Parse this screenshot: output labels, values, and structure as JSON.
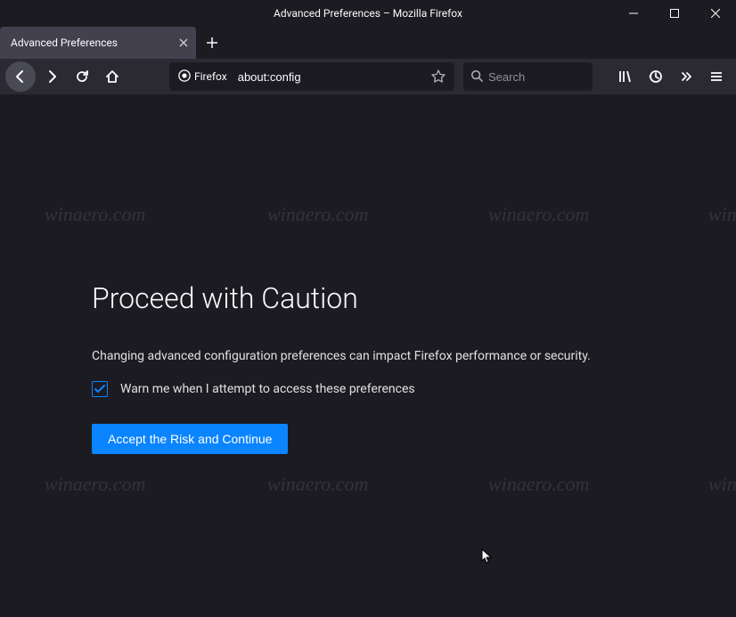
{
  "window": {
    "title": "Advanced Preferences – Mozilla Firefox"
  },
  "tab": {
    "label": "Advanced Preferences"
  },
  "urlbar": {
    "identity_label": "Firefox",
    "value": "about:config"
  },
  "searchbar": {
    "placeholder": "Search"
  },
  "content": {
    "title": "Proceed with Caution",
    "description": "Changing advanced configuration preferences can impact Firefox performance or security.",
    "checkbox_label": "Warn me when I attempt to access these preferences",
    "checkbox_checked": true,
    "accept_button": "Accept the Risk and Continue"
  },
  "watermark_text": "winaero.com"
}
